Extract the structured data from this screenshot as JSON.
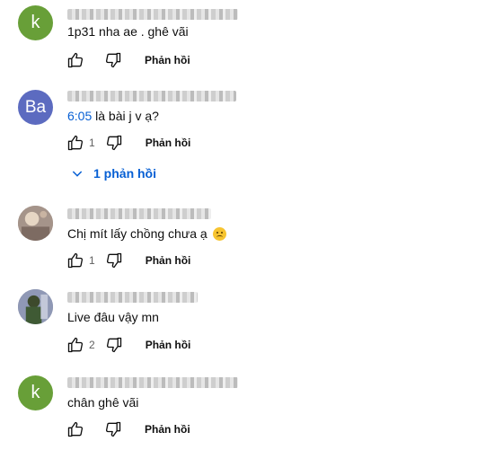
{
  "comments": [
    {
      "avatar_letter": "k",
      "avatar_color": "#689f38",
      "text": "1p31 nha ae . ghê vãi",
      "like_count": "",
      "reply_label": "Phản hồi"
    },
    {
      "avatar_letter": "Ba",
      "avatar_color": "#5c6bc0",
      "timestamp": "6:05",
      "text": " là bài j v ạ?",
      "like_count": "1",
      "reply_label": "Phản hồi",
      "replies_link": "1 phản hồi"
    },
    {
      "avatar_letter": "",
      "text": "Chị mít lấy chồng chưa ạ",
      "emoji": "worried-face-emoji",
      "like_count": "1",
      "reply_label": "Phản hồi"
    },
    {
      "avatar_letter": "",
      "text": "Live đâu vậy mn",
      "like_count": "2",
      "reply_label": "Phản hồi"
    },
    {
      "avatar_letter": "k",
      "avatar_color": "#689f38",
      "text": "chân ghê vãi",
      "like_count": "",
      "reply_label": "Phản hồi"
    }
  ],
  "icons": {
    "like": "thumbs-up-icon",
    "dislike": "thumbs-down-icon",
    "expand": "chevron-down-icon"
  },
  "colors": {
    "link": "#065fd4",
    "text": "#0f0f0f",
    "secondary": "#606060"
  }
}
